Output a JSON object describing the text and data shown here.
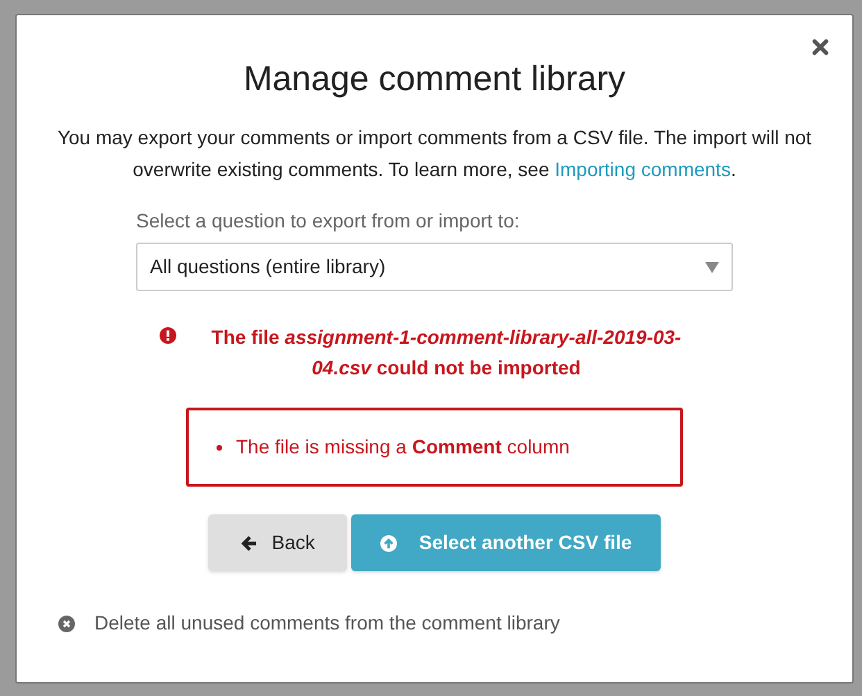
{
  "dialog": {
    "title": "Manage comment library",
    "intro": "You may export your comments or import comments from a CSV file. The import will not overwrite existing comments. To learn more, see ",
    "intro_link": "Importing comments",
    "intro_end": ".",
    "select_label": "Select a question to export from or import to:",
    "select_value": "All questions (entire library)",
    "error_title": "The file *assignment-1-comment-library-all-2019-03-04.csv* could not be imported",
    "error_items": [
      "The file is missing a **Comment** column"
    ],
    "buttons": [
      {
        "kind": "back",
        "label": "Back"
      },
      {
        "kind": "upload",
        "label": "Select another CSV file"
      }
    ],
    "delete_link": "Delete all unused comments from the comment library"
  }
}
